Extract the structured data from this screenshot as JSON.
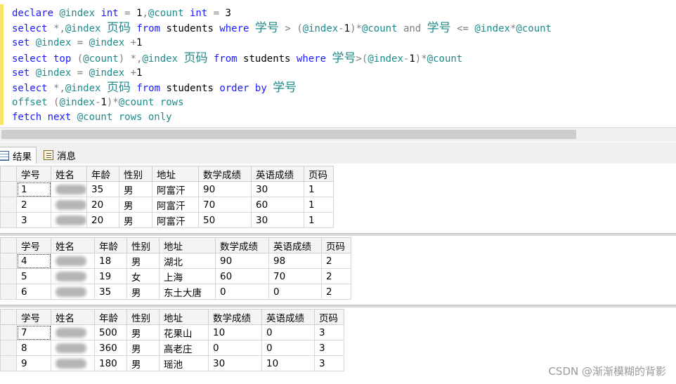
{
  "editor": {
    "lines": [
      [
        [
          "kw",
          "declare "
        ],
        [
          "var",
          "@index "
        ],
        [
          "kw",
          "int"
        ],
        [
          "op",
          " = "
        ],
        [
          "txt",
          "1"
        ],
        [
          "op",
          ","
        ],
        [
          "var",
          "@count "
        ],
        [
          "kw",
          "int"
        ],
        [
          "op",
          " = "
        ],
        [
          "txt",
          "3"
        ]
      ],
      [
        [
          "kw",
          "select "
        ],
        [
          "op",
          "*,"
        ],
        [
          "var",
          "@index "
        ],
        [
          "str",
          "页码"
        ],
        [
          "kw",
          " from "
        ],
        [
          "txt",
          "students "
        ],
        [
          "kw",
          "where "
        ],
        [
          "str",
          "学号"
        ],
        [
          "op",
          " > ("
        ],
        [
          "var",
          "@index"
        ],
        [
          "op",
          "-"
        ],
        [
          "txt",
          "1"
        ],
        [
          "op",
          ")*"
        ],
        [
          "var",
          "@count "
        ],
        [
          "op",
          "and "
        ],
        [
          "str",
          "学号"
        ],
        [
          "op",
          " <= "
        ],
        [
          "var",
          "@index"
        ],
        [
          "op",
          "*"
        ],
        [
          "var",
          "@count"
        ]
      ],
      [
        [
          "kw",
          "set "
        ],
        [
          "var",
          "@index "
        ],
        [
          "op",
          "= "
        ],
        [
          "var",
          "@index "
        ],
        [
          "op",
          "+"
        ],
        [
          "txt",
          "1"
        ]
      ],
      [
        [
          "kw",
          "select top "
        ],
        [
          "op",
          "("
        ],
        [
          "var",
          "@count"
        ],
        [
          "op",
          ") *,"
        ],
        [
          "var",
          "@index "
        ],
        [
          "str",
          "页码"
        ],
        [
          "kw",
          " from "
        ],
        [
          "txt",
          "students "
        ],
        [
          "kw",
          "where "
        ],
        [
          "str",
          "学号"
        ],
        [
          "op",
          ">("
        ],
        [
          "var",
          "@index"
        ],
        [
          "op",
          "-"
        ],
        [
          "txt",
          "1"
        ],
        [
          "op",
          ")*"
        ],
        [
          "var",
          "@count"
        ]
      ],
      [
        [
          "kw",
          "set "
        ],
        [
          "var",
          "@index "
        ],
        [
          "op",
          "= "
        ],
        [
          "var",
          "@index "
        ],
        [
          "op",
          "+"
        ],
        [
          "txt",
          "1"
        ]
      ],
      [
        [
          "kw",
          "select "
        ],
        [
          "op",
          "*,"
        ],
        [
          "var",
          "@index "
        ],
        [
          "str",
          "页码"
        ],
        [
          "kw",
          " from "
        ],
        [
          "txt",
          "students "
        ],
        [
          "kw",
          "order by "
        ],
        [
          "str",
          "学号"
        ]
      ],
      [
        [
          "var",
          "offset "
        ],
        [
          "op",
          "("
        ],
        [
          "var",
          "@index"
        ],
        [
          "op",
          "-"
        ],
        [
          "txt",
          "1"
        ],
        [
          "op",
          ")*"
        ],
        [
          "var",
          "@count "
        ],
        [
          "var",
          "rows"
        ]
      ],
      [
        [
          "kw",
          "fetch next "
        ],
        [
          "var",
          "@count "
        ],
        [
          "var",
          "rows only"
        ]
      ]
    ]
  },
  "tabs": {
    "results_label": "结果",
    "messages_label": "消息"
  },
  "results": {
    "columns": [
      "学号",
      "姓名",
      "年龄",
      "性别",
      "地址",
      "数学成绩",
      "英语成绩",
      "页码"
    ],
    "grids": [
      {
        "rows": [
          [
            "1",
            "",
            "35",
            "男",
            "阿富汗",
            "90",
            "30",
            "1"
          ],
          [
            "2",
            "",
            "20",
            "男",
            "阿富汗",
            "70",
            "60",
            "1"
          ],
          [
            "3",
            "",
            "20",
            "男",
            "阿富汗",
            "50",
            "30",
            "1"
          ]
        ]
      },
      {
        "rows": [
          [
            "4",
            "",
            "18",
            "男",
            "湖北",
            "90",
            "98",
            "2"
          ],
          [
            "5",
            "",
            "19",
            "女",
            "上海",
            "60",
            "70",
            "2"
          ],
          [
            "6",
            "",
            "35",
            "男",
            "东土大唐",
            "0",
            "0",
            "2"
          ]
        ]
      },
      {
        "rows": [
          [
            "7",
            "",
            "500",
            "男",
            "花果山",
            "10",
            "0",
            "3"
          ],
          [
            "8",
            "",
            "360",
            "男",
            "高老庄",
            "0",
            "0",
            "3"
          ],
          [
            "9",
            "",
            "180",
            "男",
            "瑶池",
            "30",
            "10",
            "3"
          ]
        ]
      }
    ]
  },
  "watermark": "CSDN @渐渐模糊的背影",
  "colors": {
    "keyword": "#1a1aff",
    "variable": "#1f8a8a",
    "operator": "#808080",
    "gutter": "#f5e66a"
  }
}
